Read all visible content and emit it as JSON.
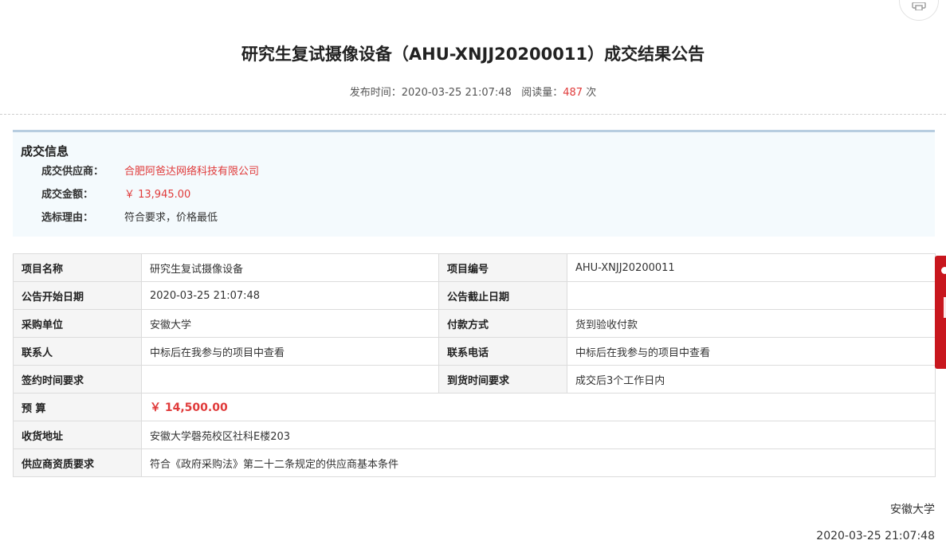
{
  "header": {
    "title": "研究生复试摄像设备（AHU-XNJJ20200011）成交结果公告",
    "publish_label": "发布时间：",
    "publish_time": "2020-03-25 21:07:48",
    "views_label": "阅读量：",
    "views_count": "487",
    "views_unit": "次"
  },
  "deal": {
    "section_title": "成交信息",
    "rows": [
      {
        "label": "成交供应商：",
        "value": "合肥阿爸达网络科技有限公司"
      },
      {
        "label": "成交金额：",
        "value": "￥ 13,945.00"
      },
      {
        "label": "选标理由：",
        "value": "符合要求，价格最低"
      }
    ]
  },
  "table": {
    "project_name_label": "项目名称",
    "project_name": "研究生复试摄像设备",
    "project_no_label": "项目编号",
    "project_no": "AHU-XNJJ20200011",
    "start_date_label": "公告开始日期",
    "start_date": "2020-03-25 21:07:48",
    "end_date_label": "公告截止日期",
    "end_date": "",
    "buyer_label": "采购单位",
    "buyer": "安徽大学",
    "payment_label": "付款方式",
    "payment": "货到验收付款",
    "contact_label": "联系人",
    "contact": "中标后在我参与的项目中查看",
    "phone_label": "联系电话",
    "phone": "中标后在我参与的项目中查看",
    "sign_time_label": "签约时间要求",
    "sign_time": "",
    "delivery_time_label": "到货时间要求",
    "delivery_time": "成交后3个工作日内",
    "budget_label": "预 算",
    "budget": "￥ 14,500.00",
    "address_label": "收货地址",
    "address": "安徽大学磬苑校区社科E楼203",
    "qualification_label": "供应商资质要求",
    "qualification": "符合《政府采购法》第二十二条规定的供应商基本条件"
  },
  "footer": {
    "organization": "安徽大学",
    "date": "2020-03-25 21:07:48"
  },
  "icons": {
    "print": "printer-icon"
  },
  "colors": {
    "accent_red": "#e03a3a",
    "side_tab_red": "#c8171e",
    "deal_box_bg": "#f4fafd",
    "deal_box_border": "#b7cde0"
  }
}
